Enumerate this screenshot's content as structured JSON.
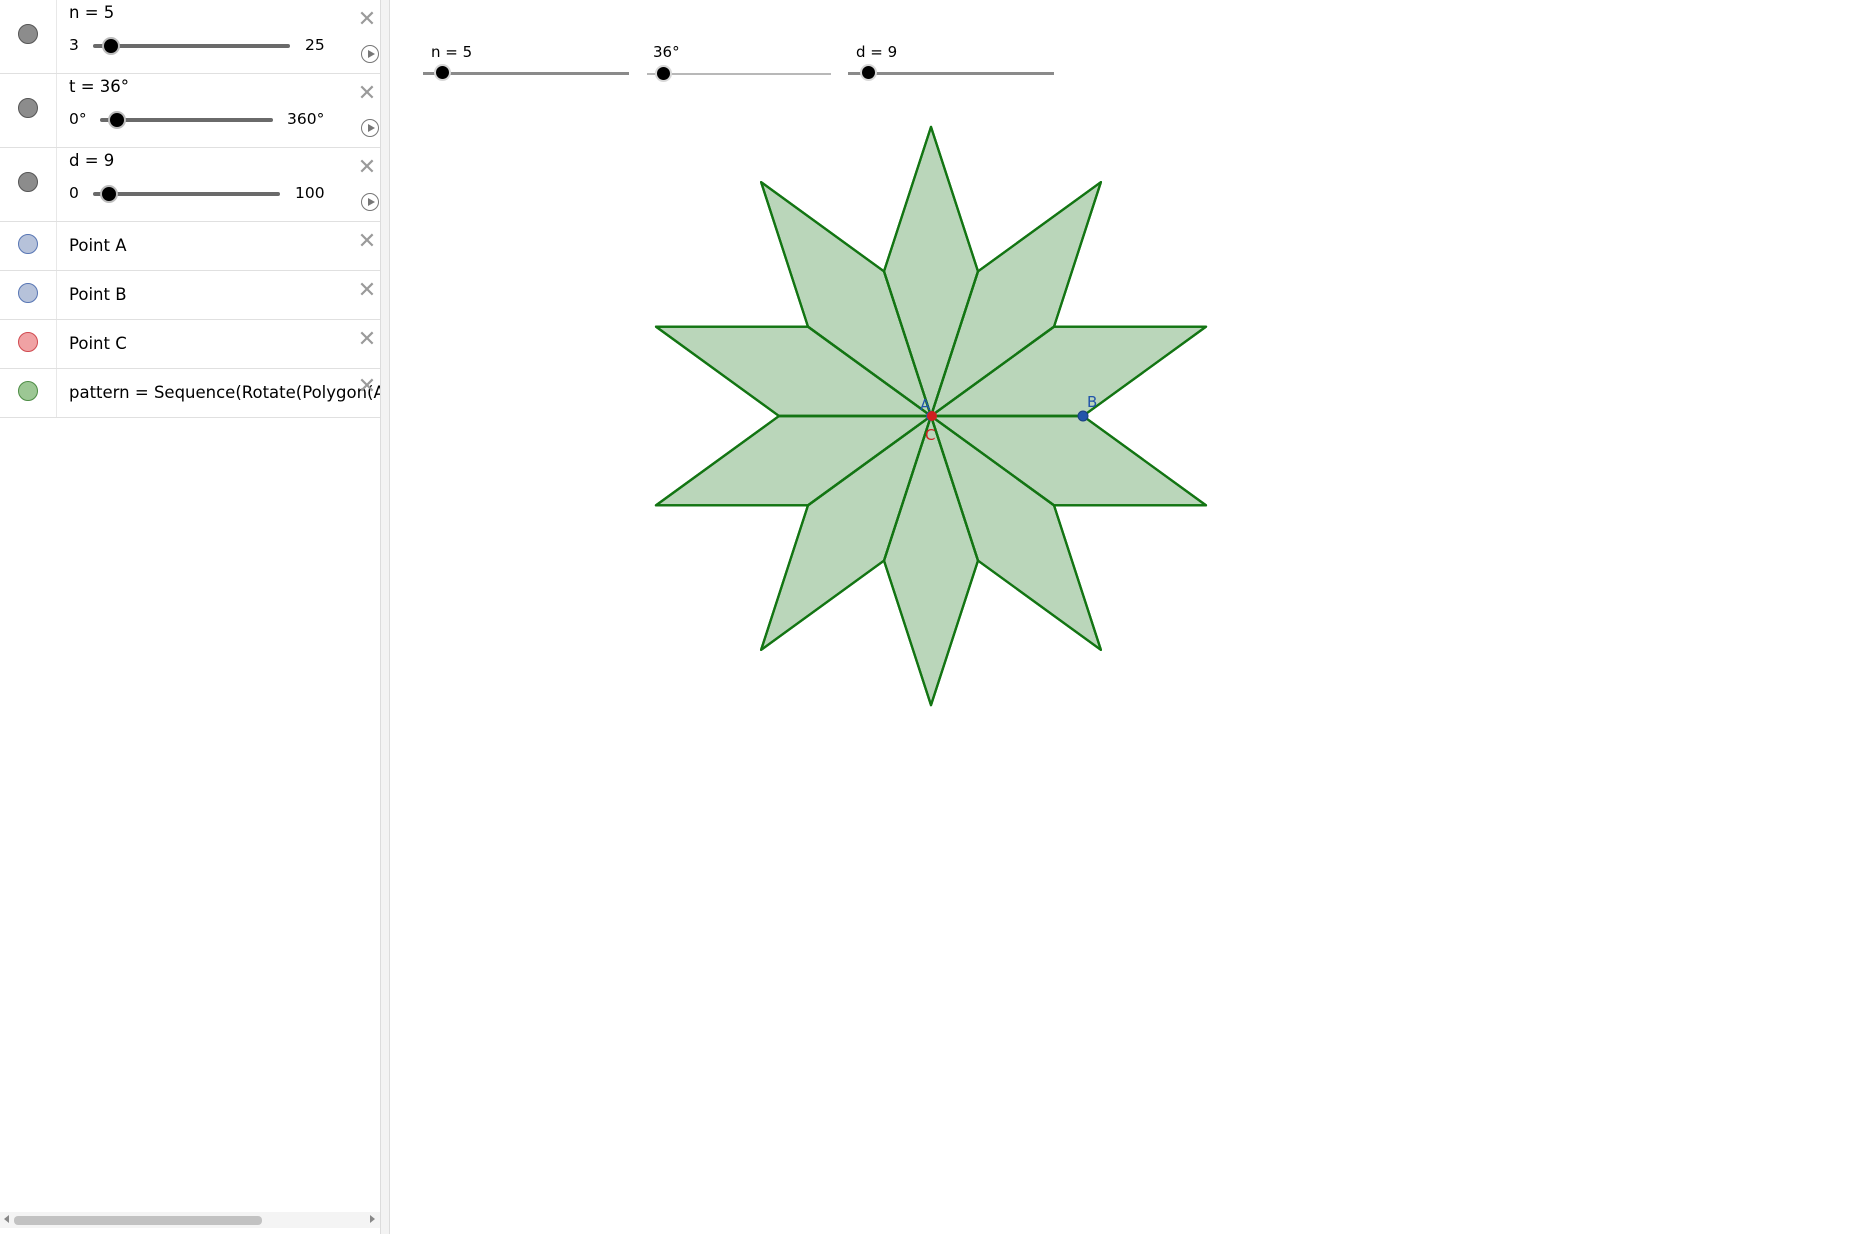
{
  "algebra": {
    "items": [
      {
        "label": "n = 5",
        "min": "3",
        "max": "25",
        "type": "slider"
      },
      {
        "label": "t = 36°",
        "min": "0°",
        "max": "360°",
        "type": "slider"
      },
      {
        "label": "d = 9",
        "min": "0",
        "max": "100",
        "type": "slider"
      },
      {
        "label": "Point A",
        "type": "point"
      },
      {
        "label": "Point B",
        "type": "point"
      },
      {
        "label": "Point C",
        "type": "point"
      },
      {
        "label": "pattern = Sequence(Rotate(Polygon(A, B",
        "type": "sequence"
      }
    ],
    "slider_values": {
      "n": 0.07,
      "t": 0.1,
      "d": 0.09
    }
  },
  "graphics": {
    "sliders": [
      {
        "label": "n = 5",
        "value_fraction": 0.1
      },
      {
        "label": "36°",
        "value_fraction": 0.1
      },
      {
        "label": "d = 9",
        "value_fraction": 0.1
      }
    ],
    "points": {
      "a": "A",
      "b": "B",
      "c": "C"
    }
  },
  "colors": {
    "stroke": "#137513",
    "point_blue": "#2255aa",
    "point_red": "#d02020",
    "fill": "#0a6a0a"
  },
  "icons": [
    "close-icon",
    "play-icon"
  ]
}
